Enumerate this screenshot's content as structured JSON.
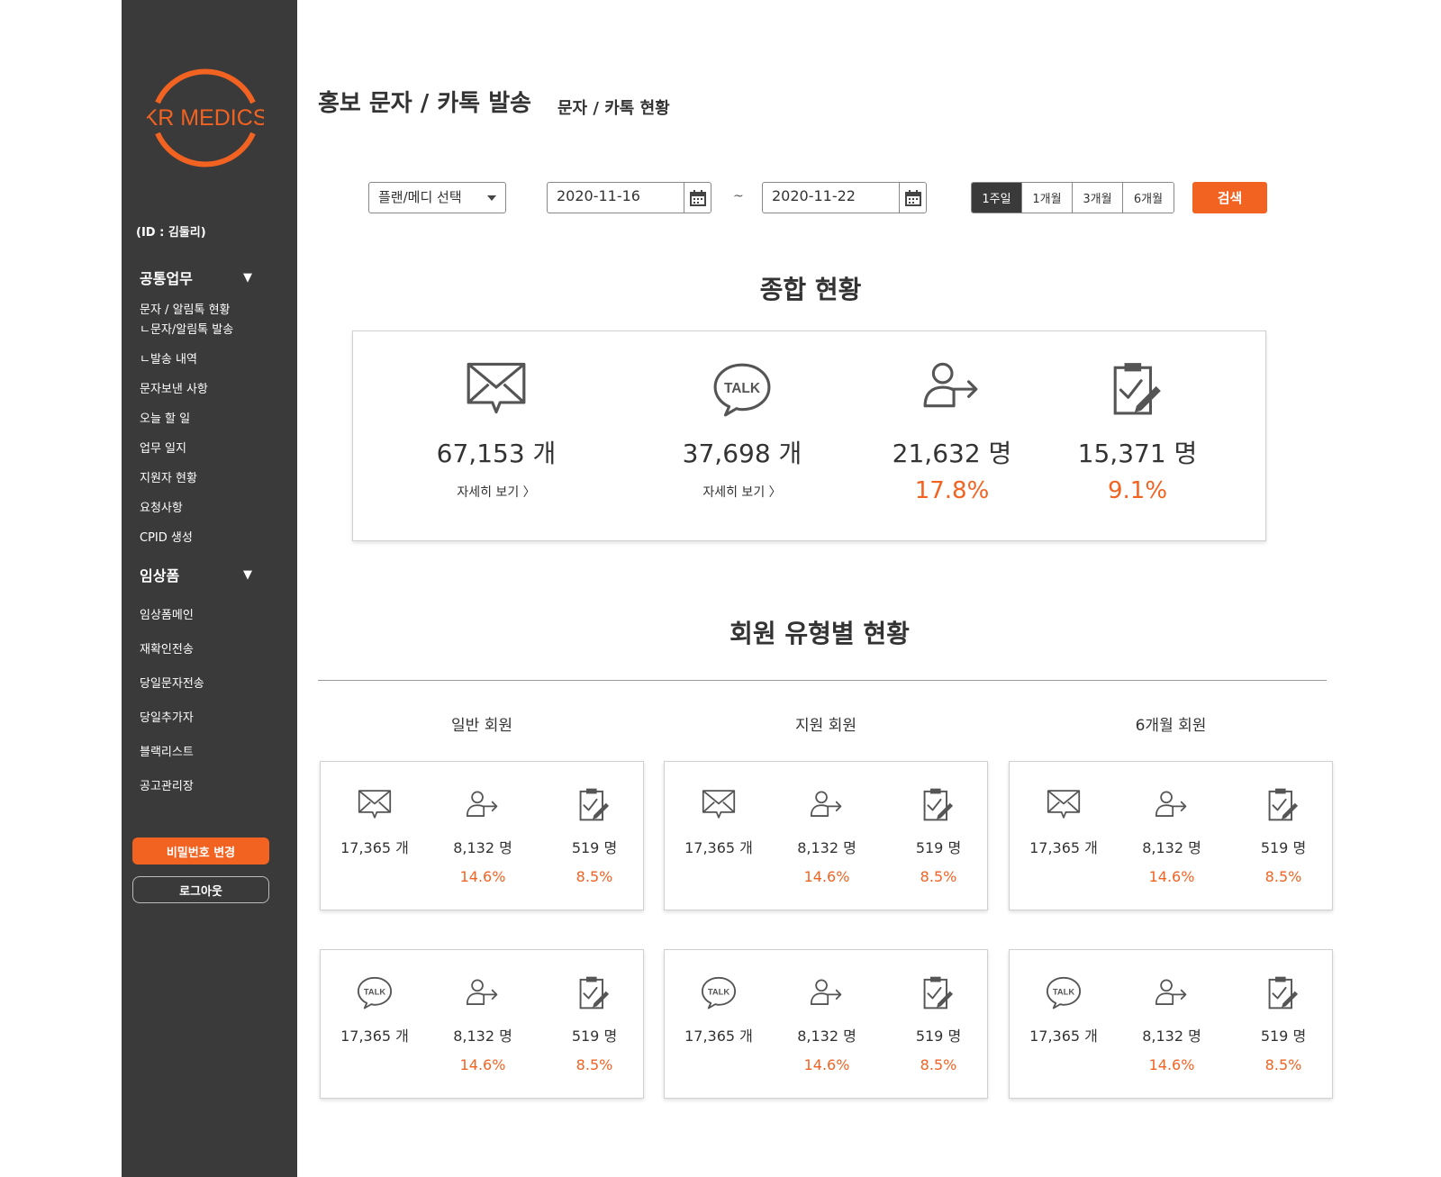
{
  "sidebar": {
    "logo_text": "KR MEDICS",
    "user_id": "(ID : 김둘리)",
    "sections": [
      {
        "label": "공통업무",
        "items": [
          "문자 / 알림톡 현황",
          "ㄴ문자/알림톡 발송",
          "ㄴ발송 내역",
          "문자보낸 사항",
          "오늘 할 일",
          "업무 일지",
          "지원자 현황",
          "요청사항",
          "CPID 생성"
        ]
      },
      {
        "label": "임상폼",
        "items": [
          "임상폼메인",
          "재확인전송",
          "당일문자전송",
          "당일추가자",
          "블랙리스트",
          "공고관리장"
        ]
      }
    ],
    "password_button": "비밀번호 변경",
    "logout_button": "로그아웃"
  },
  "header": {
    "title": "홍보 문자 / 카톡 발송",
    "subtitle": "문자 / 카톡 현황"
  },
  "filter": {
    "select_label": "플랜/메디 선택",
    "date_from": "2020-11-16",
    "date_to": "2020-11-22",
    "separator": "~",
    "periods": [
      "1주일",
      "1개월",
      "3개월",
      "6개월"
    ],
    "active_period": "1주일",
    "search_button": "검색"
  },
  "summary": {
    "title": "종합 현황",
    "items": [
      {
        "icon": "mail-icon",
        "value": "67,153 개",
        "link": "자세히 보기 〉"
      },
      {
        "icon": "talk-icon",
        "value": "37,698 개",
        "link": "자세히 보기 〉"
      },
      {
        "icon": "user-arrow-icon",
        "value": "21,632 명",
        "percent": "17.8%"
      },
      {
        "icon": "clipboard-check-icon",
        "value": "15,371 명",
        "percent": "9.1%"
      }
    ]
  },
  "member_types": {
    "title": "회원 유형별 현황",
    "groups": [
      {
        "label": "일반 회원",
        "sms": {
          "count": "17,365 개",
          "reached": "8,132 명",
          "reached_pct": "14.6%",
          "applied": "519 명",
          "applied_pct": "8.5%"
        },
        "talk": {
          "count": "17,365 개",
          "reached": "8,132 명",
          "reached_pct": "14.6%",
          "applied": "519 명",
          "applied_pct": "8.5%"
        }
      },
      {
        "label": "지원 회원",
        "sms": {
          "count": "17,365 개",
          "reached": "8,132 명",
          "reached_pct": "14.6%",
          "applied": "519 명",
          "applied_pct": "8.5%"
        },
        "talk": {
          "count": "17,365 개",
          "reached": "8,132 명",
          "reached_pct": "14.6%",
          "applied": "519 명",
          "applied_pct": "8.5%"
        }
      },
      {
        "label": "6개월 회원",
        "sms": {
          "count": "17,365 개",
          "reached": "8,132 명",
          "reached_pct": "14.6%",
          "applied": "519 명",
          "applied_pct": "8.5%"
        },
        "talk": {
          "count": "17,365 개",
          "reached": "8,132 명",
          "reached_pct": "14.6%",
          "applied": "519 명",
          "applied_pct": "8.5%"
        }
      }
    ]
  },
  "colors": {
    "accent": "#f26322",
    "sidebar_bg": "#3a3a3a",
    "text": "#333333"
  }
}
